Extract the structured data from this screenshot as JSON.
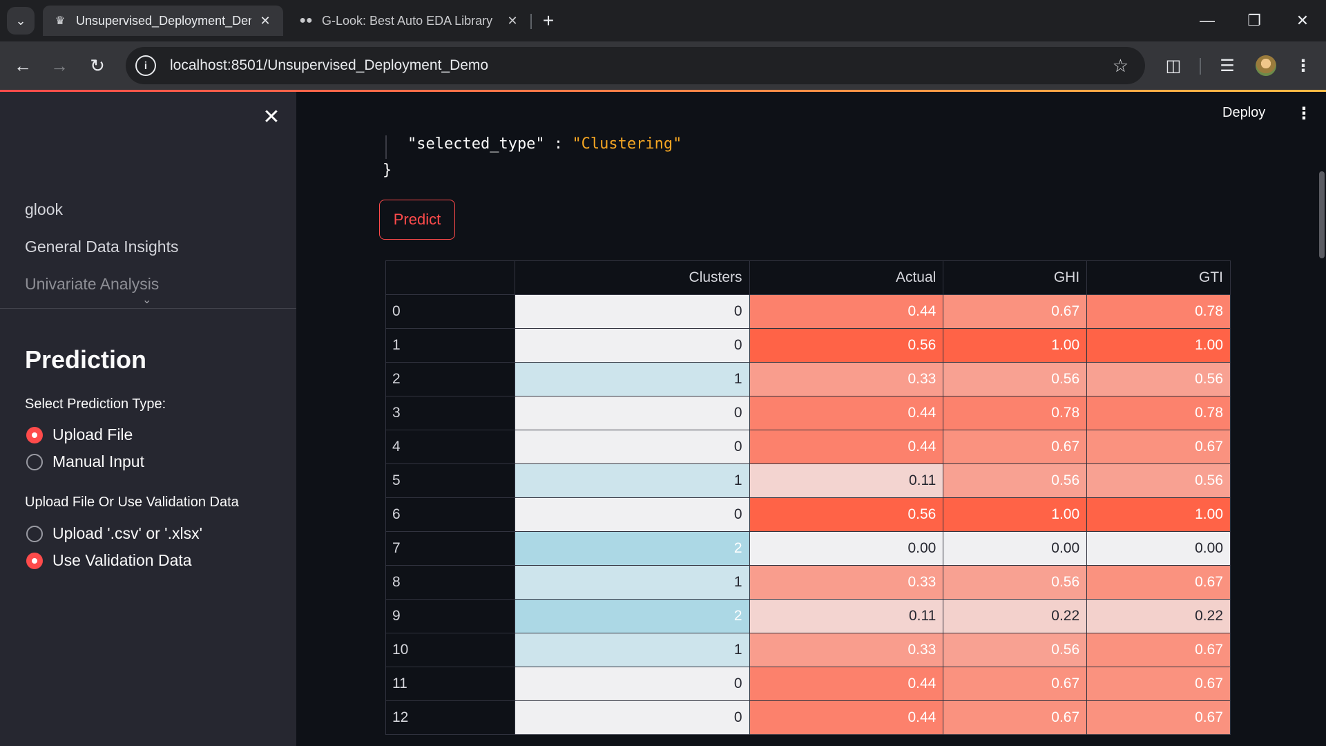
{
  "browser": {
    "tabs": [
      {
        "title": "Unsupervised_Deployment_Demo",
        "favicon": "streamlit-crown-icon",
        "active": true
      },
      {
        "title": "G-Look: Best Auto EDA Library",
        "favicon": "medium-icon",
        "active": false
      }
    ],
    "url": "localhost:8501/Unsupervised_Deployment_Demo"
  },
  "sidebar": {
    "nav": [
      "glook",
      "General Data Insights",
      "Univariate Analysis"
    ],
    "heading": "Prediction",
    "prediction_type_label": "Select Prediction Type:",
    "prediction_type_options": [
      "Upload File",
      "Manual Input"
    ],
    "prediction_type_selected": "Upload File",
    "upload_label": "Upload File Or Use Validation Data",
    "upload_options": [
      "Upload '.csv' or '.xlsx'",
      "Use Validation Data"
    ],
    "upload_selected": "Use Validation Data"
  },
  "main": {
    "deploy_label": "Deploy",
    "json_key": "\"selected_type\"",
    "json_sep": " : ",
    "json_value": "\"Clustering\"",
    "json_close": "}",
    "predict_label": "Predict"
  },
  "table": {
    "columns": [
      "",
      "Clusters",
      "Actual",
      "GHI",
      "GTI"
    ],
    "rows": [
      {
        "idx": "0",
        "Clusters": "0",
        "Actual": "0.44",
        "GHI": "0.67",
        "GTI": "0.78"
      },
      {
        "idx": "1",
        "Clusters": "0",
        "Actual": "0.56",
        "GHI": "1.00",
        "GTI": "1.00"
      },
      {
        "idx": "2",
        "Clusters": "1",
        "Actual": "0.33",
        "GHI": "0.56",
        "GTI": "0.56"
      },
      {
        "idx": "3",
        "Clusters": "0",
        "Actual": "0.44",
        "GHI": "0.78",
        "GTI": "0.78"
      },
      {
        "idx": "4",
        "Clusters": "0",
        "Actual": "0.44",
        "GHI": "0.67",
        "GTI": "0.67"
      },
      {
        "idx": "5",
        "Clusters": "1",
        "Actual": "0.11",
        "GHI": "0.56",
        "GTI": "0.56"
      },
      {
        "idx": "6",
        "Clusters": "0",
        "Actual": "0.56",
        "GHI": "1.00",
        "GTI": "1.00"
      },
      {
        "idx": "7",
        "Clusters": "2",
        "Actual": "0.00",
        "GHI": "0.00",
        "GTI": "0.00"
      },
      {
        "idx": "8",
        "Clusters": "1",
        "Actual": "0.33",
        "GHI": "0.56",
        "GTI": "0.67"
      },
      {
        "idx": "9",
        "Clusters": "2",
        "Actual": "0.11",
        "GHI": "0.22",
        "GTI": "0.22"
      },
      {
        "idx": "10",
        "Clusters": "1",
        "Actual": "0.33",
        "GHI": "0.56",
        "GTI": "0.67"
      },
      {
        "idx": "11",
        "Clusters": "0",
        "Actual": "0.44",
        "GHI": "0.67",
        "GTI": "0.67"
      },
      {
        "idx": "12",
        "Clusters": "0",
        "Actual": "0.44",
        "GHI": "0.67",
        "GTI": "0.67"
      }
    ],
    "colors": {
      "clusters": {
        "0": "#f0f0f2",
        "1": "#cde4ec",
        "2": "#acd8e5"
      },
      "heat_low": "#f0f0f2",
      "heat_high": "#ff6347"
    }
  }
}
